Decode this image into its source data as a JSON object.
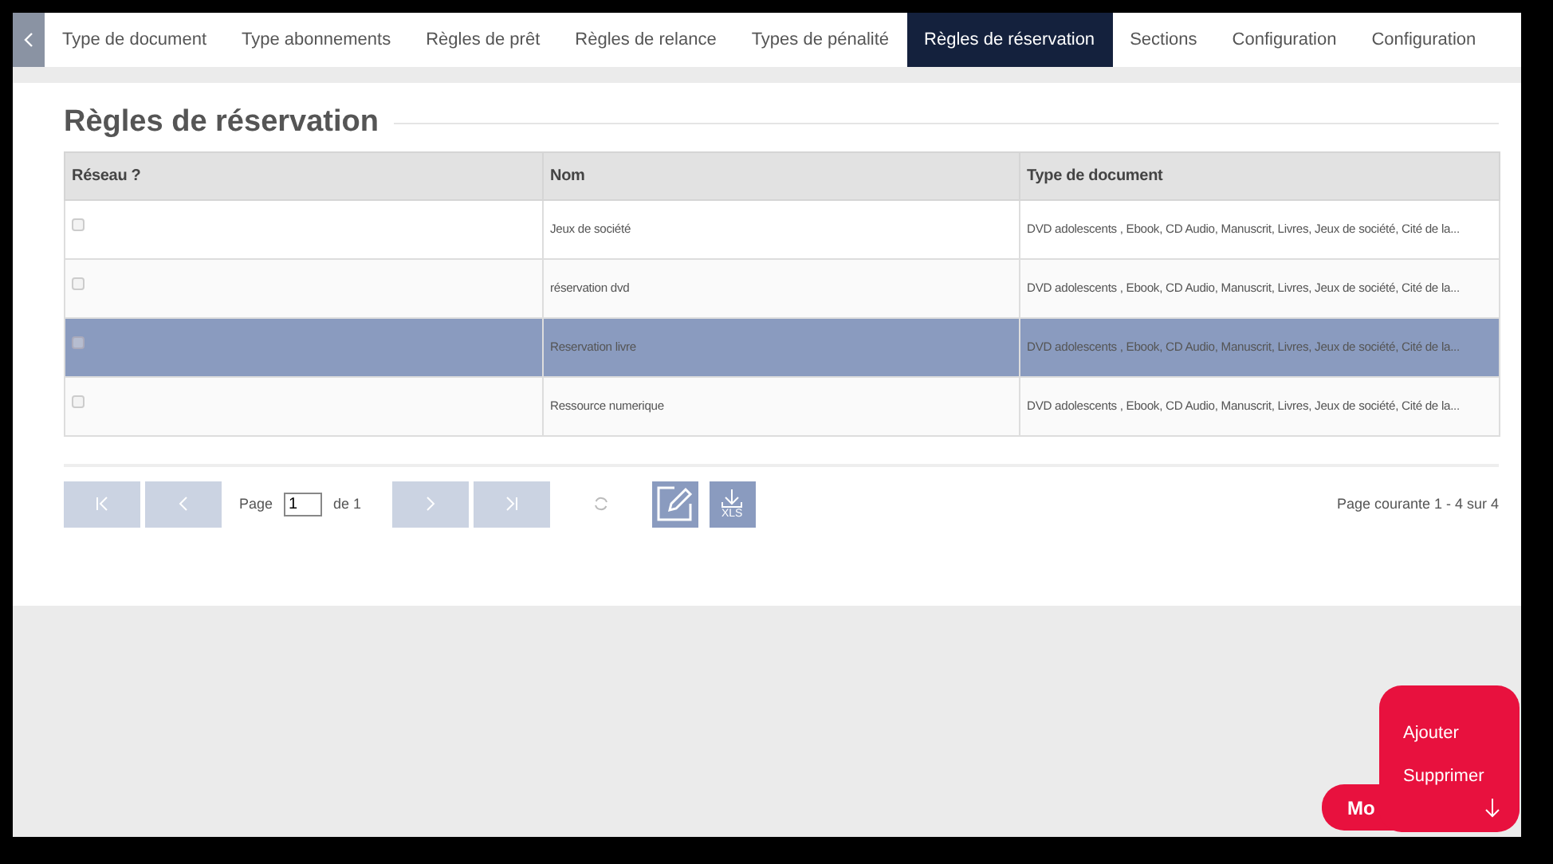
{
  "tabs": [
    {
      "label": "Type de document",
      "selected": false
    },
    {
      "label": "Type abonnements",
      "selected": false
    },
    {
      "label": "Règles de prêt",
      "selected": false
    },
    {
      "label": "Règles de relance",
      "selected": false
    },
    {
      "label": "Types de pénalité",
      "selected": false
    },
    {
      "label": "Règles de réservation",
      "selected": true
    },
    {
      "label": "Sections",
      "selected": false
    },
    {
      "label": "Configuration",
      "selected": false
    },
    {
      "label": "Configuration",
      "selected": false
    }
  ],
  "panel_title": "Règles de réservation",
  "table": {
    "columns": [
      "Réseau ?",
      "Nom",
      "Type de document"
    ],
    "rows": [
      {
        "checked": false,
        "selected": false,
        "name": "Jeux de société",
        "types": "DVD adolescents , Ebook, CD Audio, Manuscrit, Livres, Jeux de société, Cité de la..."
      },
      {
        "checked": false,
        "selected": false,
        "name": "réservation dvd",
        "types": "DVD adolescents , Ebook, CD Audio, Manuscrit, Livres, Jeux de société, Cité de la..."
      },
      {
        "checked": false,
        "selected": true,
        "name": "Reservation livre",
        "types": "DVD adolescents , Ebook, CD Audio, Manuscrit, Livres, Jeux de société, Cité de la..."
      },
      {
        "checked": false,
        "selected": false,
        "name": "Ressource numerique",
        "types": "DVD adolescents , Ebook, CD Audio, Manuscrit, Livres, Jeux de société, Cité de la..."
      }
    ]
  },
  "pager": {
    "page_label": "Page",
    "page_value": "1",
    "of_label": "de 1",
    "export_label": "XLS",
    "summary": "Page courante 1 - 4 sur 4"
  },
  "fab": {
    "label": "Mo",
    "menu": [
      "Ajouter",
      "Supprimer"
    ]
  }
}
